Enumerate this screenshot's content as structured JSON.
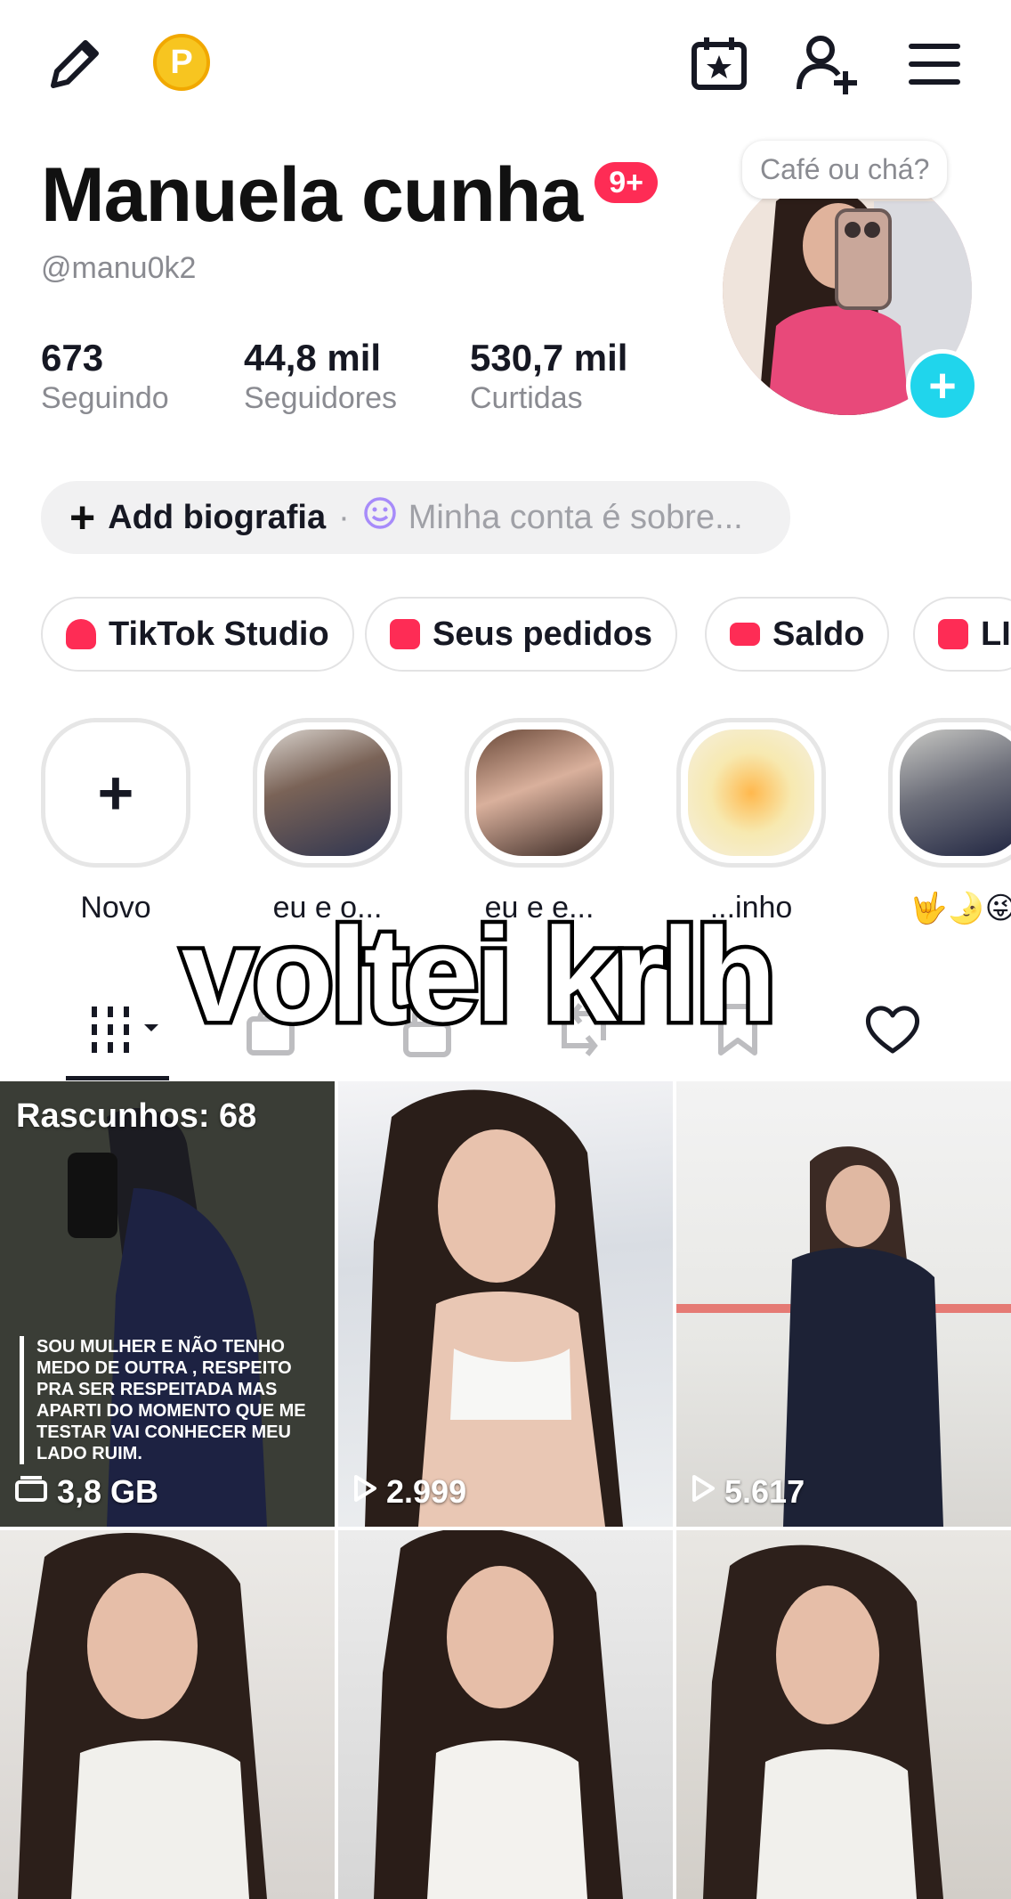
{
  "top_bar": {
    "icons": [
      "edit-pencil-icon",
      "coin-icon",
      "calendar-star-icon",
      "add-friend-icon",
      "menu-icon"
    ],
    "coin_letter": "P"
  },
  "profile": {
    "name": "Manuela cunha",
    "notification_badge": "9+",
    "handle": "@manu0k2",
    "avatar_bubble": "Café ou chá?",
    "stats": [
      {
        "value": "673",
        "label": "Seguindo"
      },
      {
        "value": "44,8 mil",
        "label": "Seguidores"
      },
      {
        "value": "530,7 mil",
        "label": "Curtidas"
      }
    ],
    "bio": {
      "add_label": "Add biografia",
      "separator": "·",
      "placeholder": "Minha conta é sobre..."
    }
  },
  "chips": [
    {
      "label": "TikTok Studio",
      "icon": "studio-icon",
      "color": "#fe2c55"
    },
    {
      "label": "Seus pedidos",
      "icon": "bag-icon",
      "color": "#fe2c55"
    },
    {
      "label": "Saldo",
      "icon": "wallet-icon",
      "color": "#fe2c55"
    },
    {
      "label": "LIV",
      "icon": "live-icon",
      "color": "#fe2c55"
    }
  ],
  "highlights": [
    {
      "label": "Novo"
    },
    {
      "label": "eu e o..."
    },
    {
      "label": "eu e e..."
    },
    {
      "label": "...inho"
    },
    {
      "label": "🤟🌛😜"
    }
  ],
  "overlay_caption": "voltei krlh",
  "tabs": [
    "videos-grid-icon",
    "shop-bag-icon",
    "private-lock-icon",
    "repost-icon",
    "bookmark-icon",
    "liked-heart-icon"
  ],
  "grid": [
    {
      "type": "drafts",
      "title": "Rascunhos: 68",
      "caption": "SOU MULHER E NÃO TENHO MEDO DE OUTRA , RESPEITO PRA SER RESPEITADA MAS APARTI DO MOMENTO QUE ME TESTAR VAI CONHECER MEU LADO RUIM.",
      "meta": "3,8 GB"
    },
    {
      "type": "video",
      "meta": "2.999"
    },
    {
      "type": "video",
      "meta": "5.617"
    },
    {
      "type": "video",
      "meta": ""
    },
    {
      "type": "video",
      "meta": ""
    },
    {
      "type": "video",
      "meta": ""
    }
  ],
  "colors": {
    "accent": "#fe2c55",
    "add_button": "#20d5ec",
    "coin": "#f7c520"
  }
}
